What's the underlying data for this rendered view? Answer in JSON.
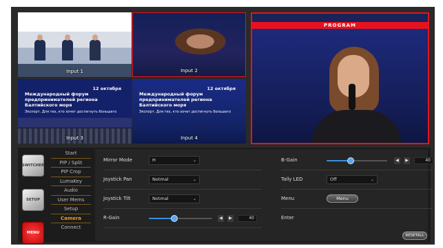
{
  "multiview": {
    "inputs": [
      {
        "label": "Input 1"
      },
      {
        "label": "Input 2"
      },
      {
        "label": "Input 3"
      },
      {
        "label": "Input 4"
      }
    ],
    "input3_banner": {
      "title": "Международный форум предпринимателей региона Балтийского моря",
      "date": "12 октября",
      "subtitle": "Экспорт. Для тех, кто хочет достигнуть большего"
    },
    "input4_banner": {
      "title": "Международный форум предпринимателей региона Балтийского моря",
      "date": "12 октября",
      "subtitle": "Экспорт. Для тех, кто хочет достигнуть большего"
    },
    "program_label": "PROGRAM"
  },
  "side_buttons": {
    "switcher": "SWITCHER",
    "setup": "SETUP",
    "menu": "MENU"
  },
  "menu": {
    "items": [
      "Start",
      "PIP / Split",
      "PIP Crop",
      "LumaKey",
      "Audio",
      "User Mems",
      "Setup",
      "Camera",
      "Connect"
    ],
    "active": "Camera"
  },
  "camera_settings": {
    "mirror_mode": {
      "label": "Mirror Mode",
      "value": "H"
    },
    "joystick_pan": {
      "label": "Joystick Pan",
      "value": "Notmal"
    },
    "joystick_tilt": {
      "label": "Joystick Tilt",
      "value": "Notmal"
    },
    "r_gain": {
      "label": "R-Gain",
      "value": "40",
      "level": 0.4
    },
    "b_gain": {
      "label": "B-Gain",
      "value": "40",
      "level": 0.4
    },
    "tally_led": {
      "label": "Tally LED",
      "value": "Off"
    },
    "menu": {
      "label": "Menu",
      "button": "Menu"
    },
    "enter": {
      "label": "Enter"
    },
    "reset_button": "RESETALL"
  },
  "colors": {
    "accent": "#f39a1e",
    "tally_red": "#e8121e",
    "slider_blue": "#3b8fe0"
  },
  "icons": {
    "left_arrow": "◀",
    "right_arrow": "▶",
    "chevron": "⌄"
  }
}
